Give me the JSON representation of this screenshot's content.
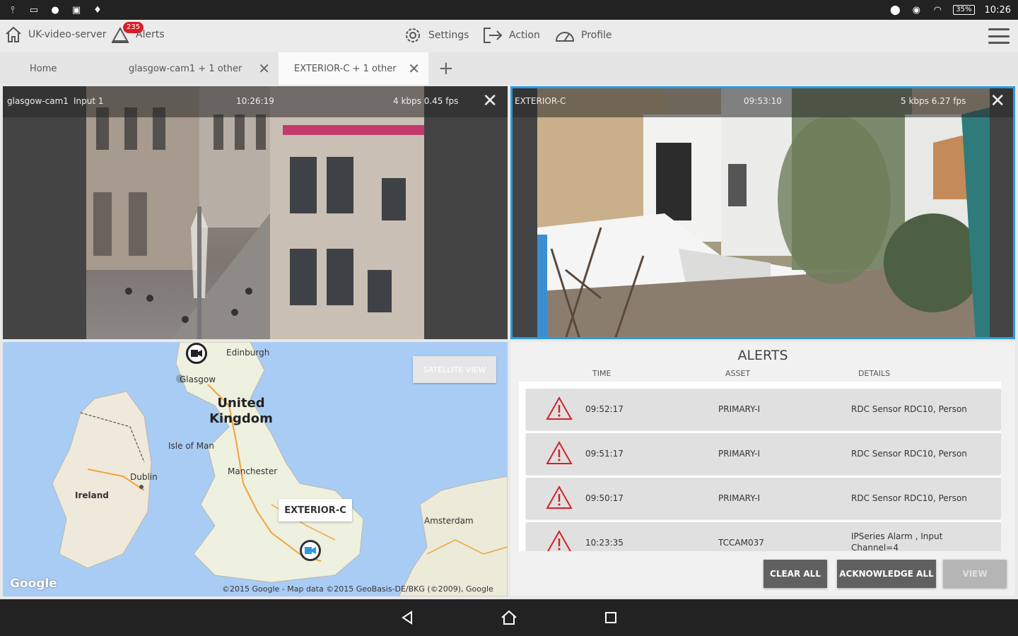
{
  "status_bar": {
    "left_icons": [
      "usb-icon",
      "keyboard-icon",
      "mic-icon",
      "photo-icon",
      "bulb-icon"
    ],
    "right_icons": [
      "location-icon",
      "alarm-icon",
      "wifi-icon"
    ],
    "battery": "35",
    "time": "10:26"
  },
  "app_bar": {
    "server_name": "UK-video-server",
    "alerts_label": "Alerts",
    "alerts_count": "235",
    "settings_label": "Settings",
    "action_label": "Action",
    "profile_label": "Profile"
  },
  "tabs": [
    {
      "label": "Home"
    },
    {
      "label": "glasgow-cam1 + 1 other"
    },
    {
      "label": "EXTERIOR-C + 1 other"
    }
  ],
  "video_left": {
    "camera": "glasgow-cam1",
    "input": "Input 1",
    "time": "10:26:19",
    "stats": "4 kbps 0.45 fps"
  },
  "video_right": {
    "camera": "EXTERIOR-C",
    "time": "09:53:10",
    "stats": "5 kbps 6.27 fps"
  },
  "map": {
    "satellite_button": "SATELLITE VIEW",
    "labels": {
      "edinburgh": "Edinburgh",
      "glasgow": "Glasgow",
      "uk": "United Kingdom",
      "isle_of_man": "Isle of Man",
      "manchester": "Manchester",
      "dublin": "Dublin",
      "ireland": "Ireland",
      "amsterdam": "Amsterdam"
    },
    "popup": "EXTERIOR-C",
    "copyright": "©2015 Google - Map data ©2015 GeoBasis-DE/BKG (©2009), Google",
    "logo": "Google"
  },
  "alerts": {
    "title": "ALERTS",
    "columns": {
      "time": "TIME",
      "asset": "ASSET",
      "details": "DETAILS"
    },
    "rows": [
      {
        "time": "09:52:17",
        "asset": "PRIMARY-I",
        "details": "RDC Sensor RDC10, Person"
      },
      {
        "time": "09:51:17",
        "asset": "PRIMARY-I",
        "details": "RDC Sensor RDC10, Person"
      },
      {
        "time": "09:50:17",
        "asset": "PRIMARY-I",
        "details": "RDC Sensor RDC10, Person"
      },
      {
        "time": "10:23:35",
        "asset": "TCCAM037",
        "details": "IPSeries Alarm , Input Channel=4"
      }
    ],
    "buttons": {
      "clear_all": "CLEAR ALL",
      "acknowledge_all": "ACKNOWLEDGE ALL",
      "view": "VIEW"
    }
  },
  "colors": {
    "accent": "#2d9be0",
    "alert": "#d32027"
  }
}
